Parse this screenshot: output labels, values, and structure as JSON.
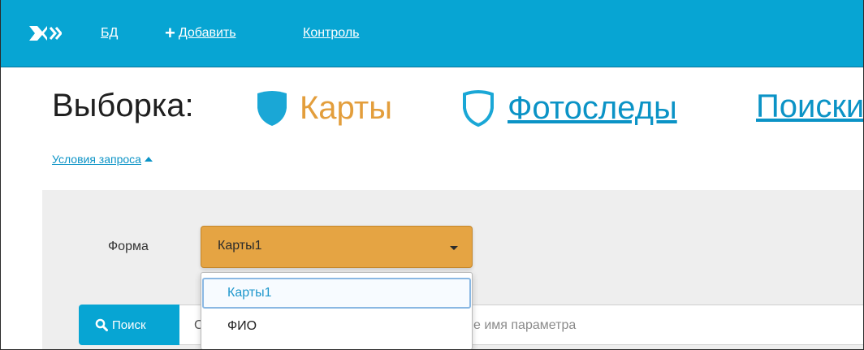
{
  "nav": {
    "logo_icon": "shield-logo-icon",
    "items": [
      {
        "label": "БД"
      },
      {
        "icon": "plus-icon",
        "label": "Добавить"
      },
      {
        "label": "Контроль"
      }
    ]
  },
  "heading": {
    "title": "Выборка:",
    "options": [
      {
        "label": "Карты",
        "icon": "shield-filled-icon",
        "selected": true
      },
      {
        "label": "Фотоследы",
        "icon": "shield-outline-icon",
        "selected": false
      },
      {
        "label": "Поиски",
        "selected": false
      }
    ]
  },
  "conditions": {
    "label": "Условия запроса"
  },
  "form": {
    "label": "Форма",
    "value": "Карты1",
    "options": [
      "Карты1",
      "ФИО"
    ]
  },
  "search": {
    "button_label": "Поиск",
    "input_start": "С",
    "placeholder_tail": "е имя параметра"
  },
  "colors": {
    "topbar": "#07a5d3",
    "accent_orange": "#e5a443",
    "link_blue": "#0b93c6",
    "panel": "#eeeeee"
  }
}
